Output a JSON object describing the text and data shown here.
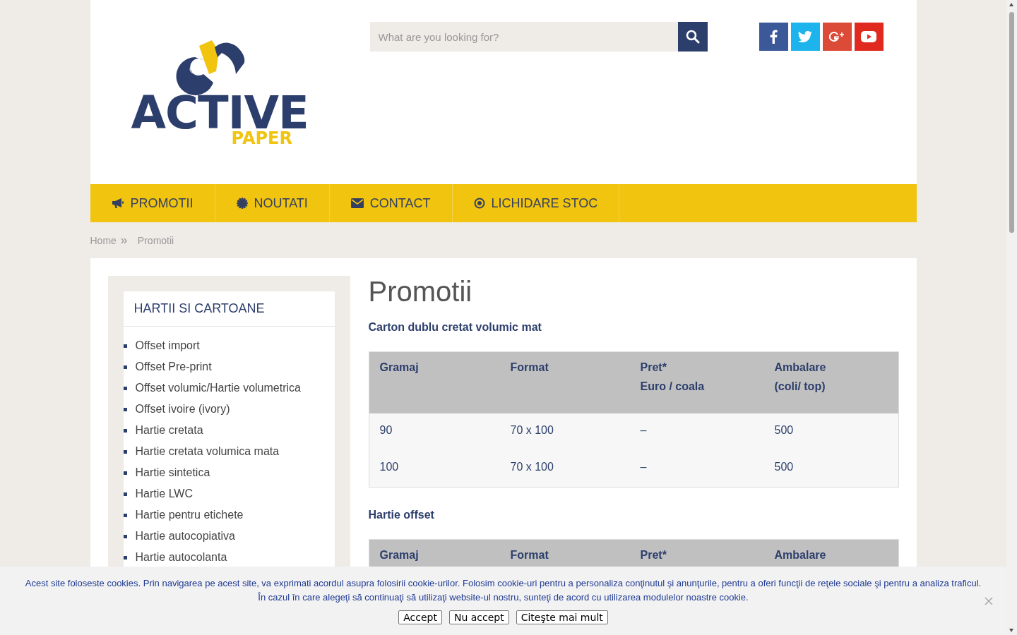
{
  "header": {
    "logo": {
      "name": "ACTIVE",
      "tagline": "PAPER"
    },
    "search": {
      "placeholder": "What are you looking for?"
    }
  },
  "nav": [
    {
      "label": "PROMOTII"
    },
    {
      "label": "NOUTATI"
    },
    {
      "label": "CONTACT"
    },
    {
      "label": "LICHIDARE STOC"
    }
  ],
  "breadcrumb": [
    "Home",
    "Promotii"
  ],
  "sidebar": {
    "title": "HARTII SI CARTOANE",
    "items": [
      "Offset import",
      "Offset Pre-print",
      "Offset volumic/Hartie volumetrica",
      "Offset ivoire (ivory)",
      "Hartie cretata",
      "Hartie cretata volumica mata",
      "Hartie sintetica",
      "Hartie LWC",
      "Hartie pentru etichete",
      "Hartie autocopiativa",
      "Hartie autocolanta"
    ]
  },
  "page": {
    "title": "Promotii",
    "sections": [
      {
        "title": "Carton dublu cretat volumic mat",
        "columns": [
          {
            "label": "Gramaj"
          },
          {
            "label": "Format"
          },
          {
            "label": "Pret*",
            "sublabel": "Euro / coala"
          },
          {
            "label": "Ambalare",
            "sublabel": "(coli/ top)"
          }
        ],
        "rows": [
          [
            "90",
            "70 x 100",
            "–",
            "500"
          ],
          [
            "100",
            "70 x 100",
            "–",
            "500"
          ]
        ]
      },
      {
        "title": "Hartie offset",
        "columns": [
          {
            "label": "Gramaj"
          },
          {
            "label": "Format"
          },
          {
            "label": "Pret*"
          },
          {
            "label": "Ambalare"
          }
        ]
      }
    ]
  },
  "cookie_bar": {
    "lines": [
      "Acest site foloseste cookies. Prin navigarea pe acest site, va exprimati acordul asupra folosirii cookie-urilor. Folosim cookie-uri pentru a personaliza conţinutul şi anunţurile, pentru a oferi funcţii de reţele sociale şi pentru a analiza traficul.",
      "În cazul în care alegeţi să continuaţi să utilizaţi website-ul nostru, sunteţi de acord cu utilizarea modulelor noastre cookie."
    ],
    "buttons": [
      "Accept",
      "Nu accept",
      "Citeşte mai mult"
    ]
  }
}
